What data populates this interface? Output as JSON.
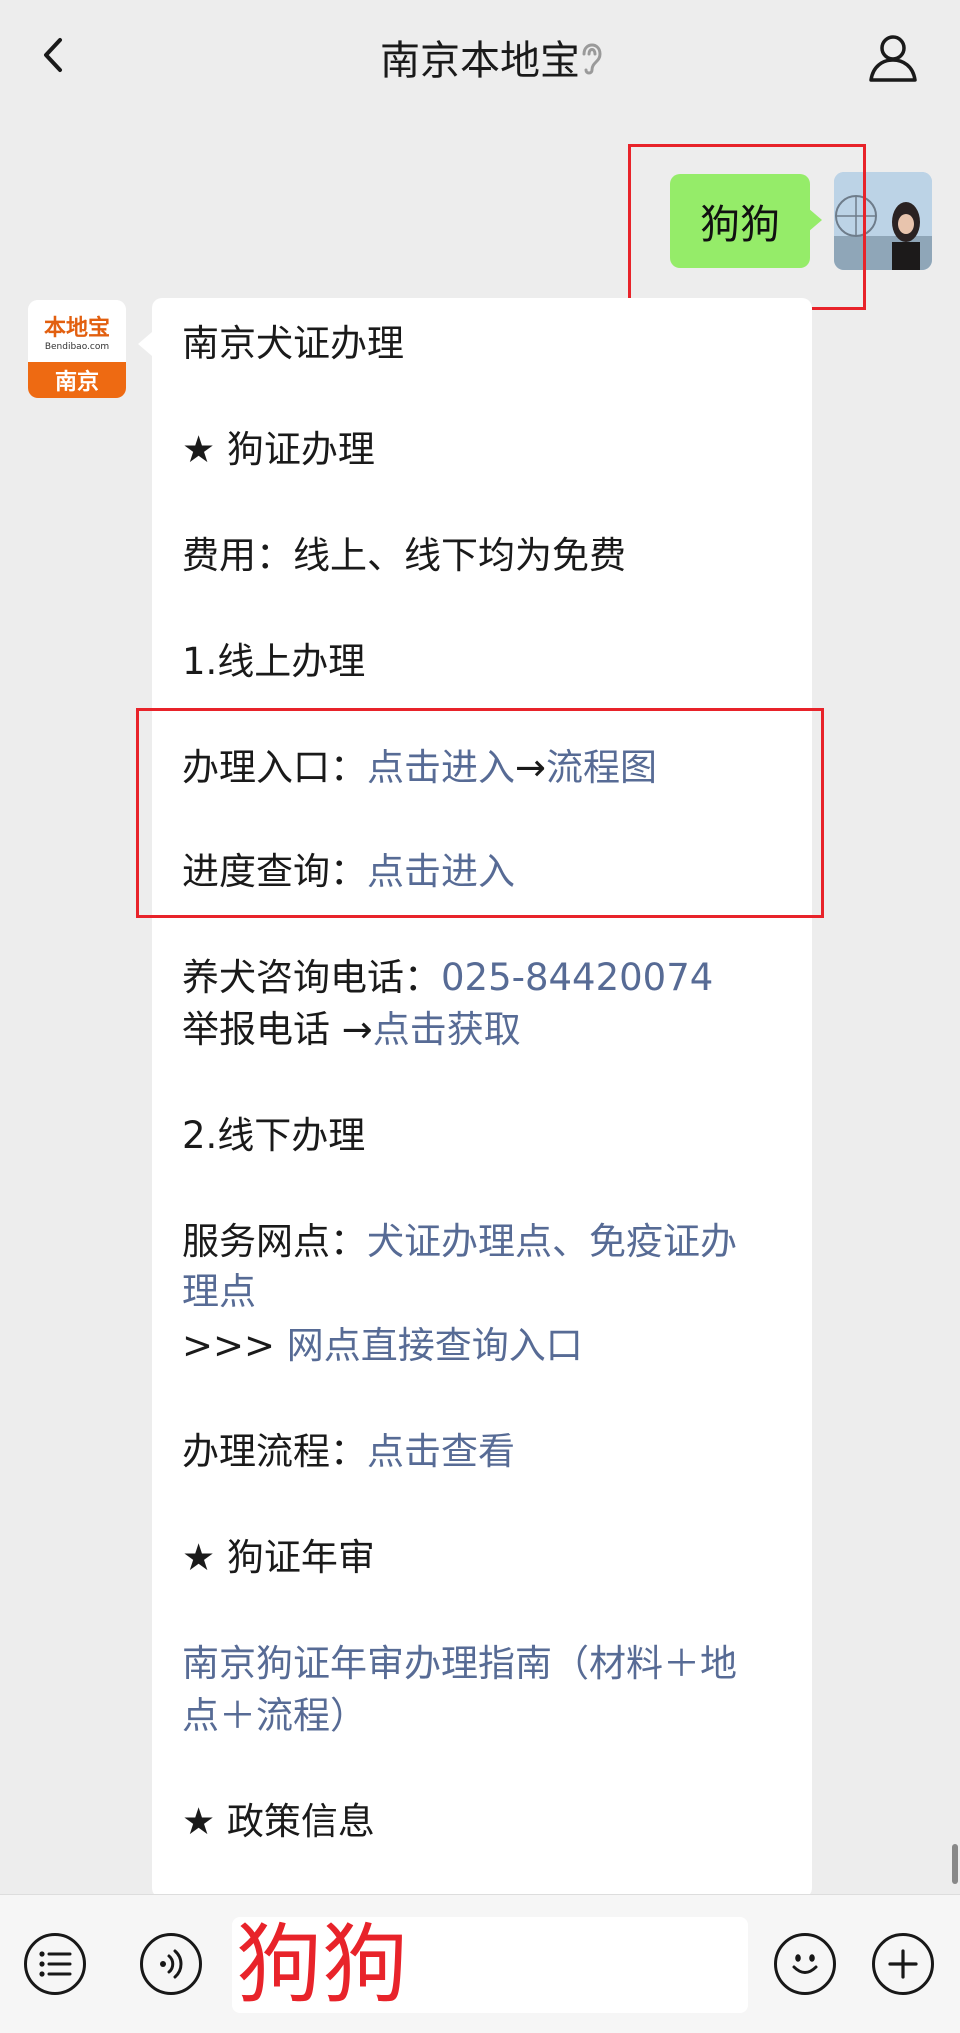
{
  "header": {
    "title": "南京本地宝"
  },
  "sent_message": {
    "text": "狗狗"
  },
  "brand_avatar": {
    "logo_text": "本地宝",
    "url_text": "Bendibao.com",
    "city": "南京"
  },
  "reply": {
    "title": "南京犬证办理",
    "section1": "★ 狗证办理",
    "fee": "费用：线上、线下均为免费",
    "online": "1.线上办理",
    "entry_label": "办理入口：",
    "entry_link": "点击进入",
    "arrow": "→",
    "flow_link": "流程图",
    "progress_label": "进度查询：",
    "progress_link": "点击进入",
    "phone_label": "养犬咨询电话：",
    "phone_number": "025-84420074",
    "report_label": "举报电话 →",
    "report_link": "点击获取",
    "offline": "2.线下办理",
    "service_label": "服务网点：",
    "service_link_1": "犬证办理点、免疫证办",
    "service_link_2": "理点",
    "query_prefix": ">>>",
    "query_link": "网点直接查询入口",
    "process_label": "办理流程：",
    "process_link": "点击查看",
    "section2": "★ 狗证年审",
    "annual_link_1": "南京狗证年审办理指南（材料＋地",
    "annual_link_2": "点＋流程）",
    "section3": "★ 政策信息"
  },
  "input": {
    "text": "狗狗"
  },
  "colors": {
    "sent_bubble": "#95ec69",
    "link": "#576b95",
    "highlight": "#e8232a",
    "brand": "#ee6a12"
  },
  "icons": [
    "back-chevron-icon",
    "ear-icon",
    "person-icon",
    "list-icon",
    "voice-icon",
    "emoji-icon",
    "plus-icon"
  ]
}
